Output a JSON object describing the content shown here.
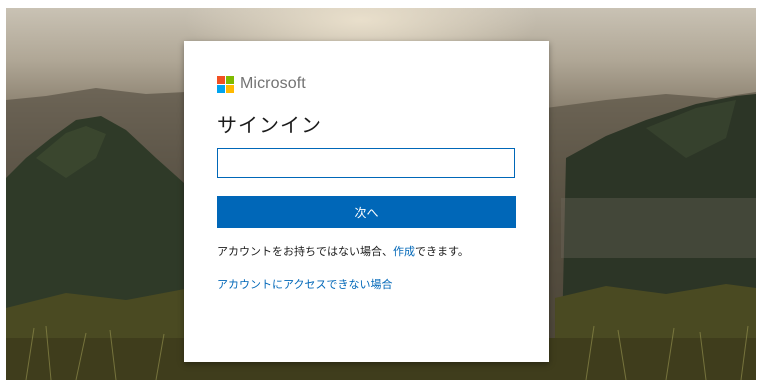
{
  "brand": {
    "name": "Microsoft",
    "colors": {
      "red": "#f25022",
      "green": "#7fba00",
      "blue": "#00a4ef",
      "yellow": "#ffb900",
      "accent": "#0067b8"
    }
  },
  "signin": {
    "title": "サインイン",
    "input_value": "",
    "next_label": "次へ",
    "no_account_prefix": "アカウントをお持ちではない場合、",
    "create_link": "作成",
    "no_account_suffix": "できます。",
    "cant_access_link": "アカウントにアクセスできない場合"
  },
  "background": {
    "description_icon": "mountain-landscape-image"
  }
}
